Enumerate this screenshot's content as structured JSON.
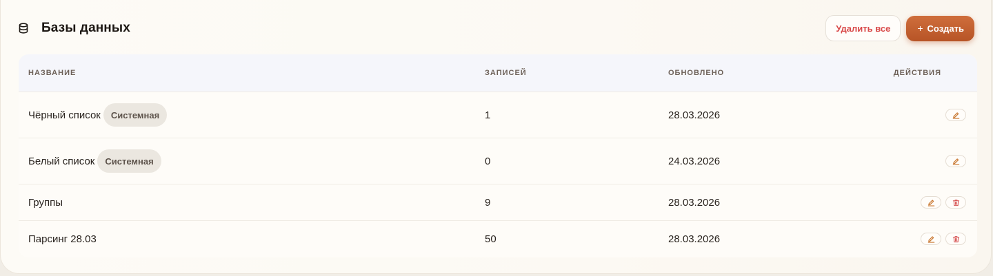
{
  "header": {
    "title": "Базы данных",
    "icon": "database-icon",
    "delete_all_label": "Удалить все",
    "create_label": "Создать",
    "create_icon_glyph": "+"
  },
  "table": {
    "columns": [
      "НАЗВАНИЕ",
      "ЗАПИСЕЙ",
      "ОБНОВЛЕНО",
      "ДЕЙСТВИЯ"
    ],
    "rows": [
      {
        "name": "Чёрный список",
        "badge": "Системная",
        "count": "1",
        "updated": "28.03.2026",
        "actions": [
          "edit"
        ]
      },
      {
        "name": "Белый список",
        "badge": "Системная",
        "count": "0",
        "updated": "24.03.2026",
        "actions": [
          "edit"
        ]
      },
      {
        "name": "Группы",
        "count": "9",
        "updated": "28.03.2026",
        "actions": [
          "edit",
          "delete"
        ]
      },
      {
        "name": "Парсинг 28.03",
        "count": "50",
        "updated": "28.03.2026",
        "actions": [
          "edit",
          "delete"
        ]
      }
    ]
  },
  "colors": {
    "accent": "#c4622f",
    "danger": "#d94a4a",
    "edit_icon": "#c8762f",
    "delete_icon": "#d65252"
  }
}
